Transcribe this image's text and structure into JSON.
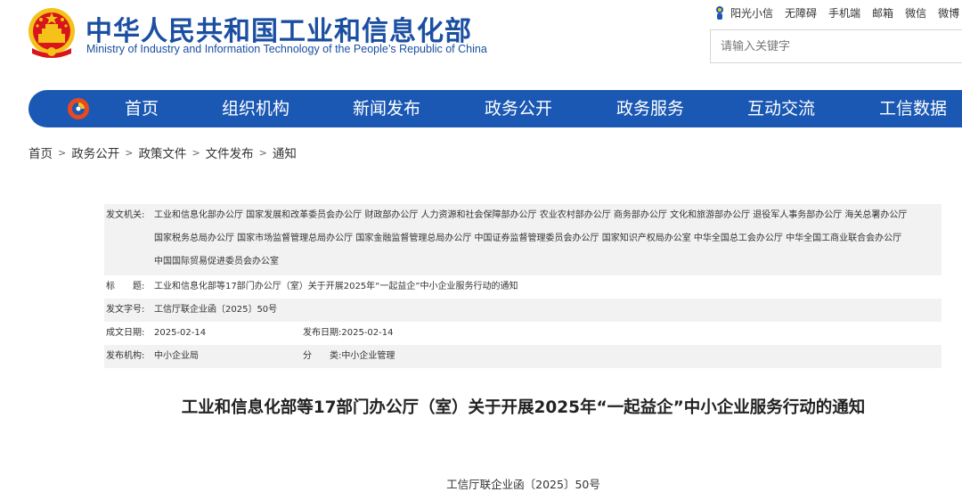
{
  "header": {
    "title_cn": "中华人民共和国工业和信息化部",
    "title_en": "Ministry of Industry and Information Technology of the People’s Republic of China"
  },
  "toplinks": [
    "阳光小信",
    "无障碍",
    "手机端",
    "邮箱",
    "微信",
    "微博"
  ],
  "search": {
    "placeholder": "请输入关键字"
  },
  "nav": [
    "首页",
    "组织机构",
    "新闻发布",
    "政务公开",
    "政务服务",
    "互动交流",
    "工信数据"
  ],
  "breadcrumb": [
    "首页",
    "政务公开",
    "政策文件",
    "文件发布",
    "通知"
  ],
  "info": {
    "issuer_label": "发文机关:",
    "issuer_lines": [
      "工业和信息化部办公厅 国家发展和改革委员会办公厅 财政部办公厅 人力资源和社会保障部办公厅 农业农村部办公厅 商务部办公厅 文化和旅游部办公厅 退役军人事务部办公厅 海关总署办公厅",
      "国家税务总局办公厅 国家市场监督管理总局办公厅 国家金融监督管理总局办公厅 中国证券监督管理委员会办公厅 国家知识产权局办公室 中华全国总工会办公厅 中华全国工商业联合会办公厅",
      "中国国际贸易促进委员会办公室"
    ],
    "title_label": "标　　题:",
    "title_value": "工业和信息化部等17部门办公厅（室）关于开展2025年“一起益企”中小企业服务行动的通知",
    "docno_label": "发文字号:",
    "docno_value": "工信厅联企业函〔2025〕50号",
    "created_label": "成文日期:",
    "created_value": "2025-02-14",
    "published_label": "发布日期:",
    "published_value": "2025-02-14",
    "org_label": "发布机构:",
    "org_value": "中小企业局",
    "category_label": "分　　类:",
    "category_value": "中小企业管理"
  },
  "document": {
    "title": "工业和信息化部等17部门办公厅（室）关于开展2025年“一起益企”中小企业服务行动的通知",
    "number": "工信厅联企业函〔2025〕50号"
  },
  "colors": {
    "brand_blue": "#1a58b3",
    "title_blue": "#1b4fa1",
    "emblem_red": "#d7151a",
    "emblem_gold": "#f5c219"
  }
}
